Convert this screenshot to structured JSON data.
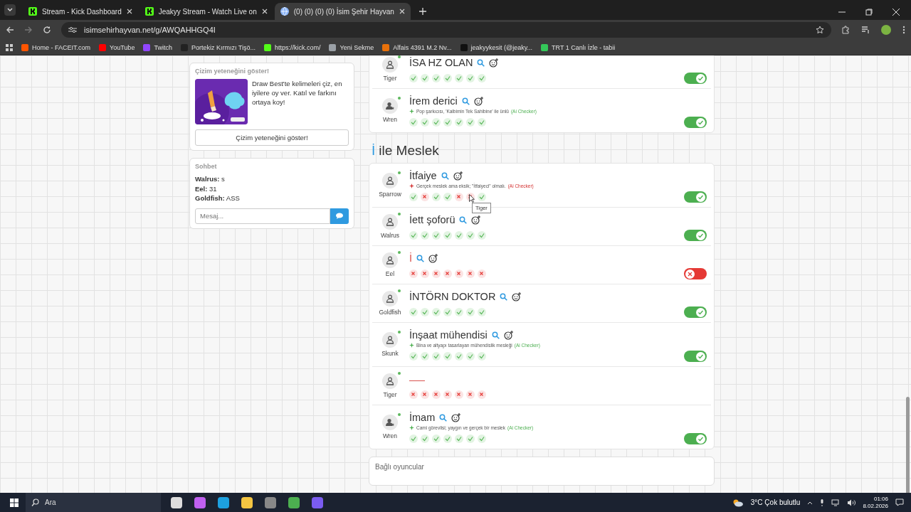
{
  "browser": {
    "tabs": [
      {
        "title": "Stream - Kick Dashboard",
        "kind": "kick",
        "selected": false
      },
      {
        "title": "Jeakyy Stream - Watch Live on",
        "kind": "kick",
        "selected": false
      },
      {
        "title": "(0) (0) (0) (0) İsim Şehir Hayvan",
        "kind": "globe",
        "selected": true
      }
    ],
    "address": "isimsehirhayvan.net/g/AWQAHHGQ4I",
    "bookmarks": [
      {
        "label": "Home - FACEIT.com",
        "color": "#ff5500"
      },
      {
        "label": "YouTube",
        "color": "#ff0000"
      },
      {
        "label": "Twitch",
        "color": "#9146ff"
      },
      {
        "label": "Portekiz Kırmızı Tişö...",
        "color": "#222222"
      },
      {
        "label": "https://kick.com/",
        "color": "#53fc18"
      },
      {
        "label": "Yeni Sekme",
        "color": "#9aa0a6"
      },
      {
        "label": "Alfais 4391 M.2 Nv...",
        "color": "#e8710a"
      },
      {
        "label": "jeakyykesit (@jeaky...",
        "color": "#111111"
      },
      {
        "label": "TRT 1 Canlı İzle - tabii",
        "color": "#34c759"
      }
    ]
  },
  "sidebar": {
    "promo": {
      "title": "Çizim yeteneğini göster!",
      "kind": "picture",
      "text": "Draw Best'te kelimeleri çiz, en iyilere oy ver. Katıl ve farkını ortaya koy!",
      "button": "Çizim yeteneğini göster!"
    },
    "chat": {
      "title": "Sohbet",
      "messages": [
        {
          "user": "Walrus:",
          "text": "s"
        },
        {
          "user": "Eel:",
          "text": "31"
        },
        {
          "user": "Goldfish:",
          "text": "ASS"
        }
      ],
      "placeholder": "Mesaj..."
    }
  },
  "sections": [
    {
      "rows": [
        {
          "player": "Tiger",
          "star": false,
          "answer": "İSA HZ OLAN",
          "kind": "valid",
          "votes": [
            {
              "ok": true
            },
            {
              "ok": true
            },
            {
              "ok": true
            },
            {
              "ok": true
            },
            {
              "ok": true
            },
            {
              "ok": true
            },
            {
              "ok": true
            }
          ],
          "accepted": true
        },
        {
          "player": "Wren",
          "star": true,
          "answer": "İrem derici",
          "kind": "valid",
          "note": "Pop şarkıcısı, 'Kalbimin Tek Sahibine' ile ünlü",
          "note_tag": "(Ai Checker)",
          "note_ok": true,
          "votes": [
            {
              "ok": true
            },
            {
              "ok": true
            },
            {
              "ok": true
            },
            {
              "ok": true
            },
            {
              "ok": true
            },
            {
              "ok": true
            },
            {
              "ok": true
            }
          ],
          "accepted": true
        }
      ]
    },
    {
      "letter": "İ",
      "title": "ile Meslek",
      "rows": [
        {
          "player": "Sparrow",
          "star": false,
          "answer": "İtfaiye",
          "kind": "valid",
          "note": "Gerçek meslek ama eksik; \"İtfaiyeci\" olmalı.",
          "note_tag": "(Ai Checker)",
          "note_ok": false,
          "votes": [
            {
              "ok": true
            },
            {
              "ok": false
            },
            {
              "ok": true
            },
            {
              "ok": true
            },
            {
              "ok": false
            },
            {
              "ok": false,
              "tooltip": "Tiger"
            },
            {
              "ok": true
            }
          ],
          "accepted": true
        },
        {
          "player": "Walrus",
          "star": false,
          "answer": "İett şoforü",
          "kind": "valid",
          "votes": [
            {
              "ok": true
            },
            {
              "ok": true
            },
            {
              "ok": true
            },
            {
              "ok": true
            },
            {
              "ok": true
            },
            {
              "ok": true
            },
            {
              "ok": true
            }
          ],
          "accepted": true
        },
        {
          "player": "Eel",
          "star": false,
          "answer": "İ",
          "kind": "invalid",
          "votes": [
            {
              "ok": false
            },
            {
              "ok": false
            },
            {
              "ok": false
            },
            {
              "ok": false
            },
            {
              "ok": false
            },
            {
              "ok": false
            },
            {
              "ok": false
            }
          ],
          "accepted": false
        },
        {
          "player": "Goldfish",
          "star": false,
          "answer": "İNTÖRN DOKTOR",
          "kind": "valid",
          "votes": [
            {
              "ok": true
            },
            {
              "ok": true
            },
            {
              "ok": true
            },
            {
              "ok": true
            },
            {
              "ok": true
            },
            {
              "ok": true
            },
            {
              "ok": true
            }
          ],
          "accepted": true
        },
        {
          "player": "Skunk",
          "star": false,
          "answer": "İnşaat mühendisi",
          "kind": "valid",
          "note": "Bina ve altyapı tasarlayan mühendislik mesleği",
          "note_tag": "(Ai Checker)",
          "note_ok": true,
          "votes": [
            {
              "ok": true
            },
            {
              "ok": true
            },
            {
              "ok": true
            },
            {
              "ok": true
            },
            {
              "ok": true
            },
            {
              "ok": true
            },
            {
              "ok": true
            }
          ],
          "accepted": true
        },
        {
          "player": "Tiger",
          "star": false,
          "kind": "empty",
          "votes": [
            {
              "ok": false
            },
            {
              "ok": false
            },
            {
              "ok": false
            },
            {
              "ok": false
            },
            {
              "ok": false
            },
            {
              "ok": false
            },
            {
              "ok": false
            }
          ]
        },
        {
          "player": "Wren",
          "star": true,
          "answer": "İmam",
          "kind": "valid",
          "note": "Cami görevlisi; yaygın ve gerçek bir meslek",
          "note_tag": "(Ai Checker)",
          "note_ok": true,
          "votes": [
            {
              "ok": true
            },
            {
              "ok": true
            },
            {
              "ok": true
            },
            {
              "ok": true
            },
            {
              "ok": true
            },
            {
              "ok": true
            },
            {
              "ok": true
            }
          ],
          "accepted": true
        }
      ]
    }
  ],
  "players_card": {
    "title": "Bağlı oyuncular"
  },
  "taskbar": {
    "search": "Ara",
    "weather": "3°C Çok bulutlu",
    "time": "01:06",
    "date": "8.02.2026"
  }
}
